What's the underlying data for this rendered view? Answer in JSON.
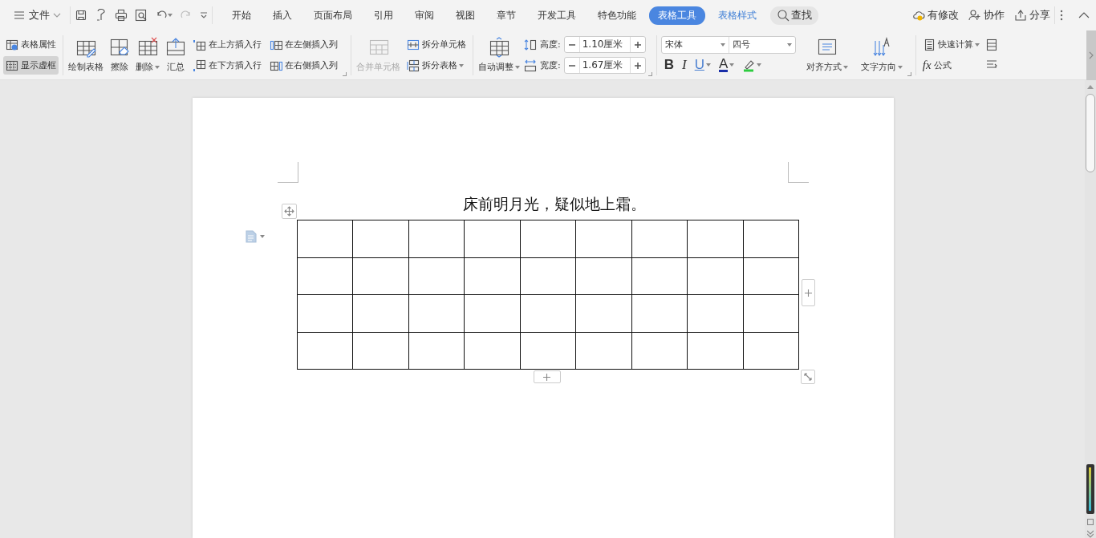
{
  "app_bar": {
    "menu": {
      "label": "文件"
    },
    "tabs": [
      {
        "label": "开始",
        "kind": "main",
        "selected": false
      },
      {
        "label": "插入",
        "kind": "main",
        "selected": false
      },
      {
        "label": "页面布局",
        "kind": "main",
        "selected": false
      },
      {
        "label": "引用",
        "kind": "main",
        "selected": false
      },
      {
        "label": "审阅",
        "kind": "main",
        "selected": false
      },
      {
        "label": "视图",
        "kind": "main",
        "selected": false
      },
      {
        "label": "章节",
        "kind": "main",
        "selected": false
      },
      {
        "label": "开发工具",
        "kind": "main",
        "selected": false
      },
      {
        "label": "特色功能",
        "kind": "main",
        "selected": false
      },
      {
        "label": "表格工具",
        "kind": "context",
        "selected": true
      },
      {
        "label": "表格样式",
        "kind": "context",
        "selected": false
      }
    ],
    "search": {
      "label": "查找"
    },
    "actions": [
      {
        "label": "有修改",
        "kind": "cloud"
      },
      {
        "label": "协作",
        "kind": "people"
      },
      {
        "label": "分享",
        "kind": "share"
      }
    ]
  },
  "ribbon": {
    "view_toggles": [
      {
        "label": "表格属性",
        "kind": "properties",
        "on": false
      },
      {
        "label": "显示虚框",
        "kind": "gridlines",
        "on": true
      }
    ],
    "draw_buttons": [
      {
        "label": "绘制表格",
        "kind": "draw",
        "dropdown": false
      },
      {
        "label": "擦除",
        "kind": "erase",
        "dropdown": false
      },
      {
        "label": "删除",
        "kind": "delete",
        "dropdown": true
      },
      {
        "label": "汇总",
        "kind": "summary",
        "dropdown": false
      }
    ],
    "insert_buttons": [
      {
        "label": "在上方插入行",
        "kind": "row-above"
      },
      {
        "label": "在下方插入行",
        "kind": "row-below"
      },
      {
        "label": "在左侧插入列",
        "kind": "col-left"
      },
      {
        "label": "在右侧插入列",
        "kind": "col-right"
      }
    ],
    "merge": {
      "label": "合并单元格",
      "disabled": true
    },
    "split_buttons": [
      {
        "label": "拆分单元格",
        "kind": "split-cells",
        "dropdown": false
      },
      {
        "label": "拆分表格",
        "kind": "split-table",
        "dropdown": true
      }
    ],
    "autofit": {
      "label": "自动调整",
      "dropdown": true
    },
    "size_fields": [
      {
        "label": "高度:",
        "kind": "height",
        "value": "1.10厘米"
      },
      {
        "label": "宽度:",
        "kind": "width",
        "value": "1.67厘米"
      }
    ],
    "font": {
      "family": "宋体",
      "size": "四号"
    },
    "format_buttons": [
      {
        "kind": "bold",
        "label": "B",
        "dropdown": false
      },
      {
        "kind": "italic",
        "label": "I",
        "dropdown": false
      },
      {
        "kind": "underline",
        "label": "U",
        "dropdown": true
      },
      {
        "kind": "font-color",
        "label": "A",
        "dropdown": true
      },
      {
        "kind": "highlight",
        "dropdown": true
      }
    ],
    "layout_buttons": [
      {
        "label": "对齐方式",
        "kind": "align",
        "dropdown": true
      },
      {
        "label": "文字方向",
        "kind": "direction",
        "dropdown": true
      }
    ],
    "calc_buttons": [
      {
        "label": "快速计算",
        "kind": "calc",
        "dropdown": true
      },
      {
        "label": "公式",
        "kind": "formula",
        "symbol": "fx",
        "dropdown": false
      }
    ]
  },
  "document": {
    "title": "床前明月光，疑似地上霜。"
  }
}
